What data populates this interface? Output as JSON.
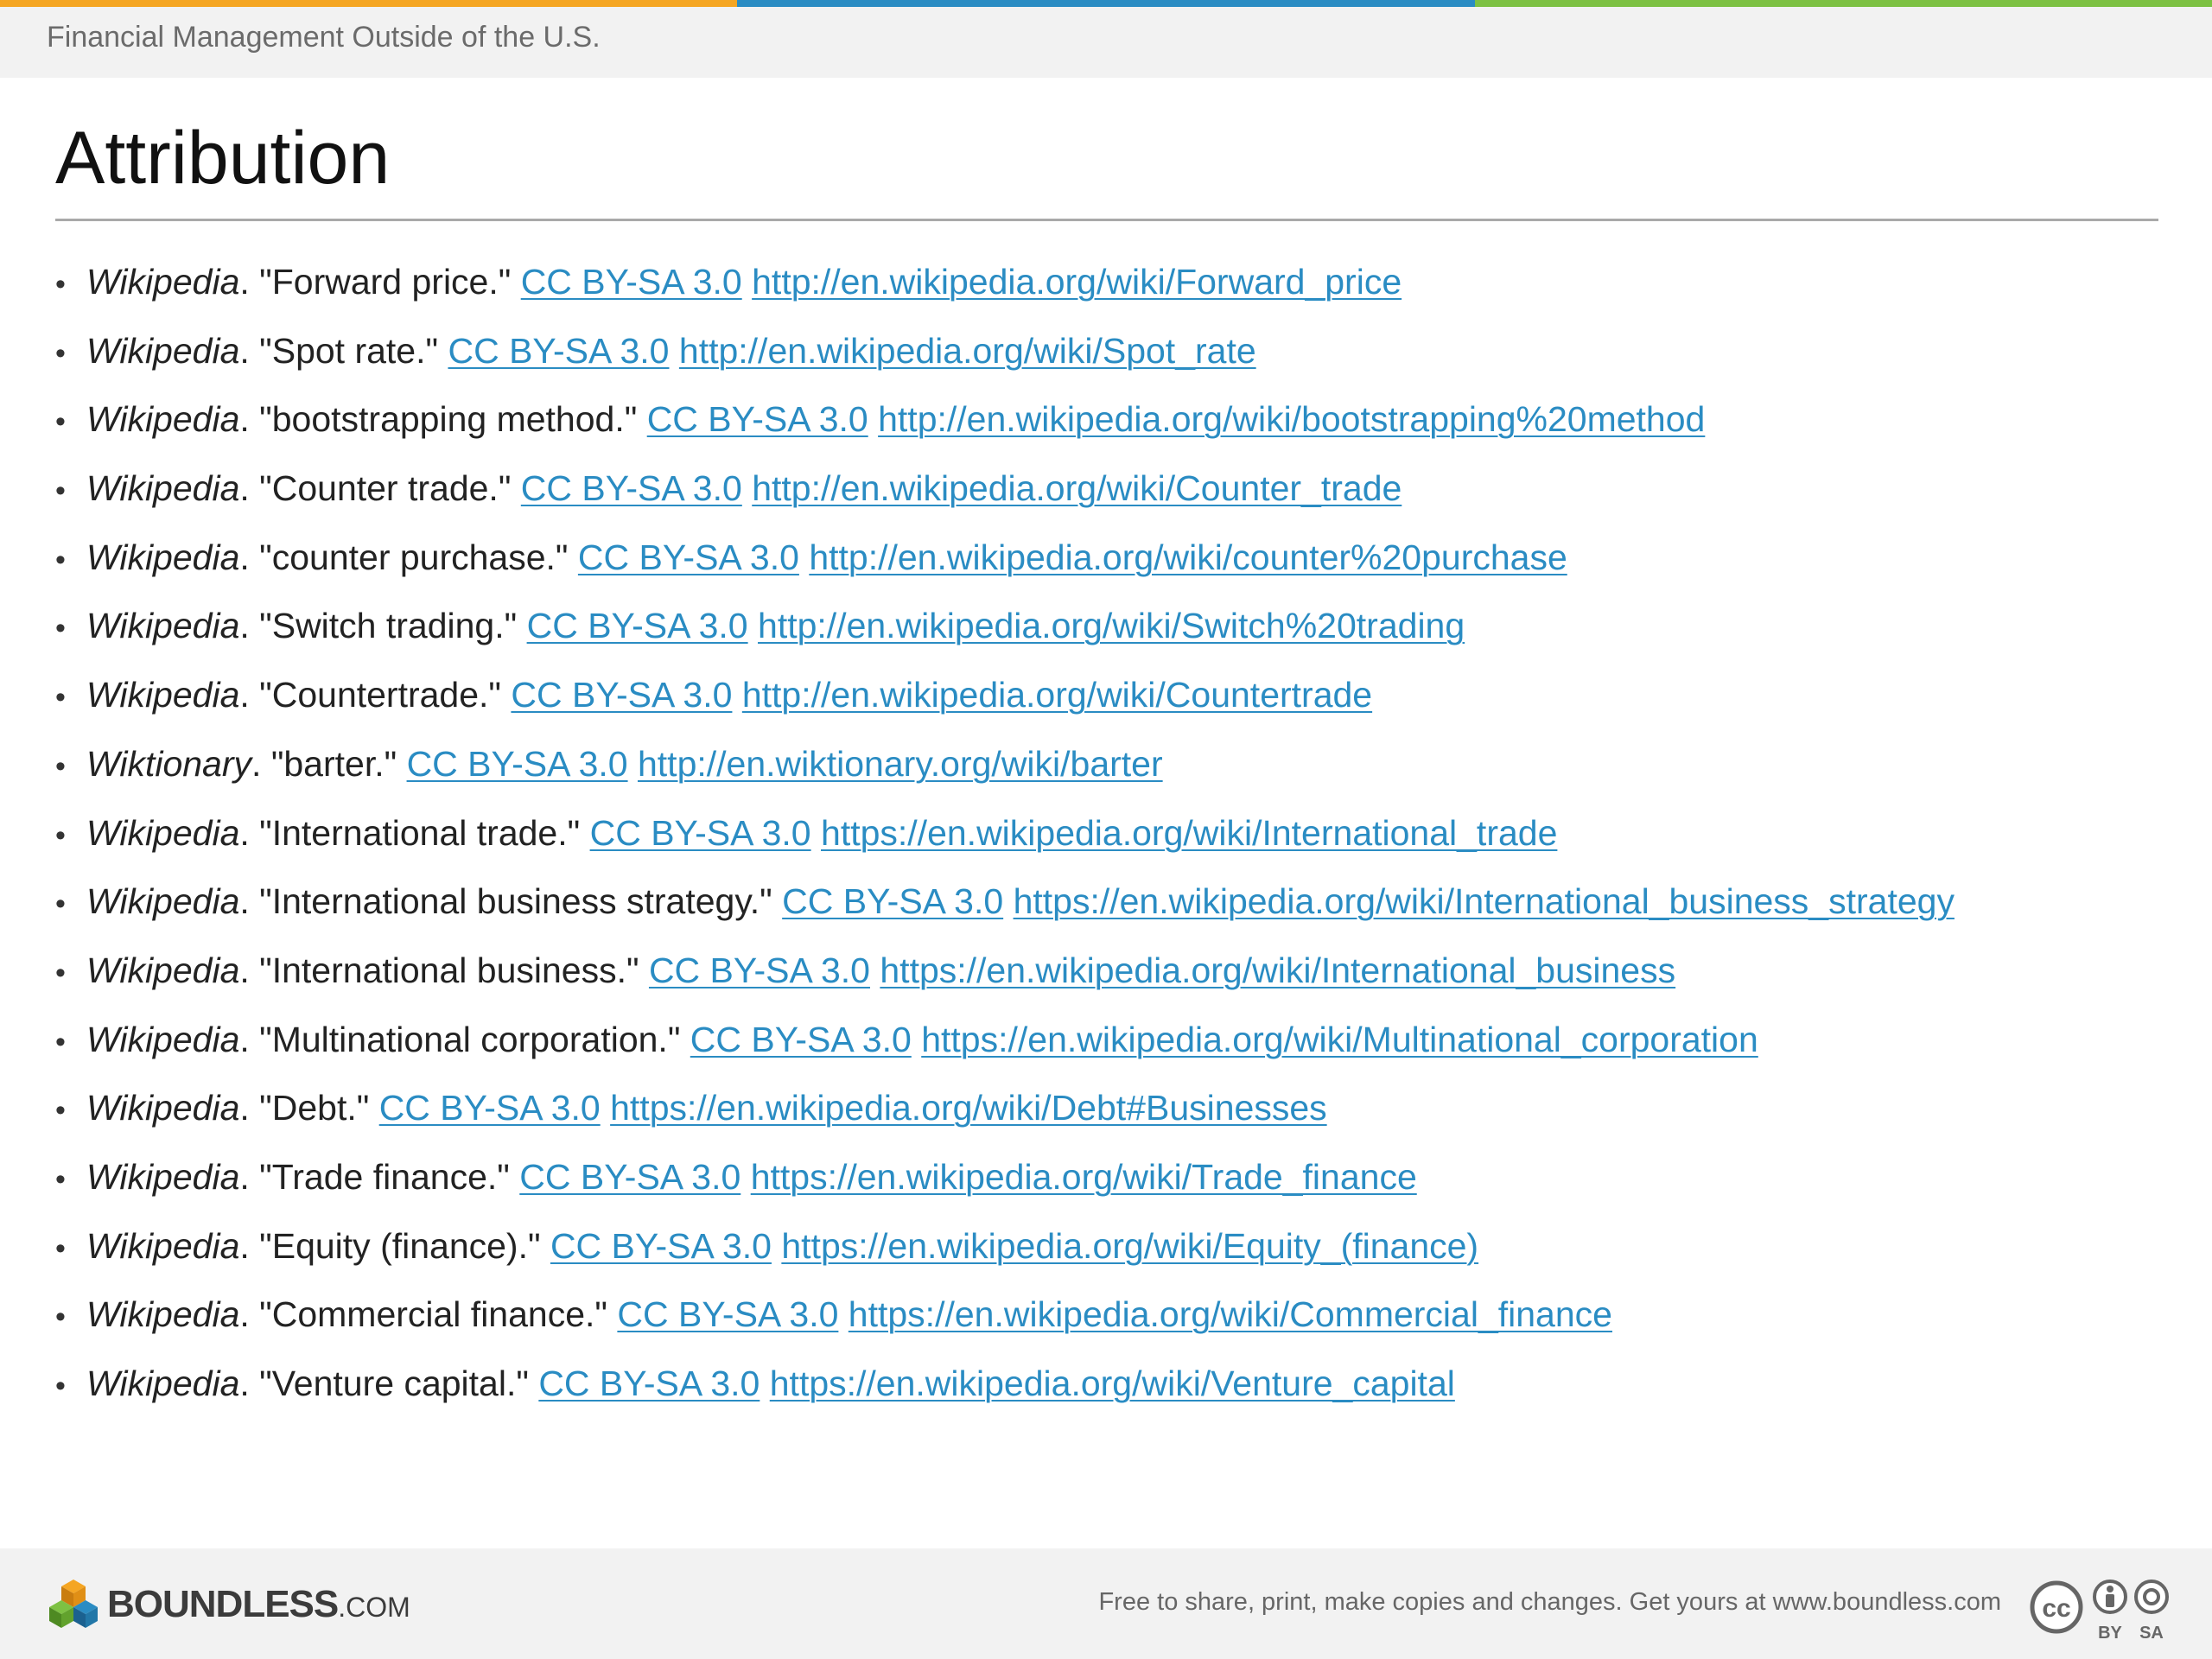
{
  "header": {
    "course_title": "Financial Management Outside of the U.S.",
    "stripe_colors": [
      "#f5a623",
      "#2a8cc3",
      "#7dc143"
    ]
  },
  "page": {
    "title": "Attribution"
  },
  "attributions": [
    {
      "source": "Wikipedia",
      "title": "\"Forward price.\"",
      "license": "CC BY-SA 3.0",
      "url": "http://en.wikipedia.org/wiki/Forward_price"
    },
    {
      "source": "Wikipedia",
      "title": "\"Spot rate.\"",
      "license": "CC BY-SA 3.0",
      "url": "http://en.wikipedia.org/wiki/Spot_rate"
    },
    {
      "source": "Wikipedia",
      "title": "\"bootstrapping method.\"",
      "license": "CC BY-SA 3.0",
      "url": "http://en.wikipedia.org/wiki/bootstrapping%20method"
    },
    {
      "source": "Wikipedia",
      "title": "\"Counter trade.\"",
      "license": "CC BY-SA 3.0",
      "url": "http://en.wikipedia.org/wiki/Counter_trade"
    },
    {
      "source": "Wikipedia",
      "title": "\"counter purchase.\"",
      "license": "CC BY-SA 3.0",
      "url": "http://en.wikipedia.org/wiki/counter%20purchase"
    },
    {
      "source": "Wikipedia",
      "title": "\"Switch trading.\"",
      "license": "CC BY-SA 3.0",
      "url": "http://en.wikipedia.org/wiki/Switch%20trading"
    },
    {
      "source": "Wikipedia",
      "title": "\"Countertrade.\"",
      "license": "CC BY-SA 3.0",
      "url": "http://en.wikipedia.org/wiki/Countertrade"
    },
    {
      "source": "Wiktionary",
      "title": "\"barter.\"",
      "license": "CC BY-SA 3.0",
      "url": "http://en.wiktionary.org/wiki/barter"
    },
    {
      "source": "Wikipedia",
      "title": "\"International trade.\"",
      "license": "CC BY-SA 3.0",
      "url": "https://en.wikipedia.org/wiki/International_trade"
    },
    {
      "source": "Wikipedia",
      "title": "\"International business strategy.\"",
      "license": "CC BY-SA 3.0",
      "url": "https://en.wikipedia.org/wiki/International_business_strategy"
    },
    {
      "source": "Wikipedia",
      "title": "\"International business.\"",
      "license": "CC BY-SA 3.0",
      "url": "https://en.wikipedia.org/wiki/International_business"
    },
    {
      "source": "Wikipedia",
      "title": "\"Multinational corporation.\"",
      "license": "CC BY-SA 3.0",
      "url": "https://en.wikipedia.org/wiki/Multinational_corporation"
    },
    {
      "source": "Wikipedia",
      "title": "\"Debt.\"",
      "license": "CC BY-SA 3.0",
      "url": "https://en.wikipedia.org/wiki/Debt#Businesses"
    },
    {
      "source": "Wikipedia",
      "title": "\"Trade finance.\"",
      "license": "CC BY-SA 3.0",
      "url": "https://en.wikipedia.org/wiki/Trade_finance"
    },
    {
      "source": "Wikipedia",
      "title": "\"Equity (finance).\"",
      "license": "CC BY-SA 3.0",
      "url": "https://en.wikipedia.org/wiki/Equity_(finance)"
    },
    {
      "source": "Wikipedia",
      "title": "\"Commercial finance.\"",
      "license": "CC BY-SA 3.0",
      "url": "https://en.wikipedia.org/wiki/Commercial_finance"
    },
    {
      "source": "Wikipedia",
      "title": "\"Venture capital.\"",
      "license": "CC BY-SA 3.0",
      "url": "https://en.wikipedia.org/wiki/Venture_capital"
    }
  ],
  "footer": {
    "logo_text": "BOUNDLESS",
    "logo_suffix": ".COM",
    "note": "Free to share, print, make copies and changes. Get yours at www.boundless.com",
    "license_badge": {
      "icon": "cc-by-sa-icon",
      "cc": "cc",
      "by": "BY",
      "sa": "SA"
    }
  }
}
